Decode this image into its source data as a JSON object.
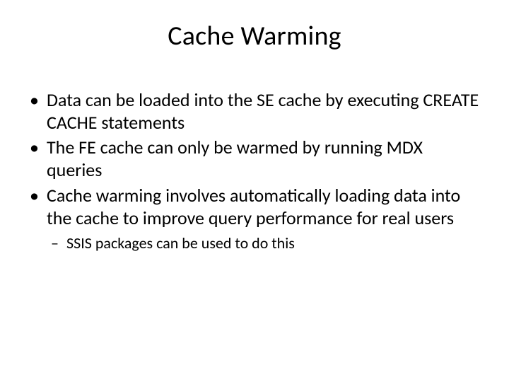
{
  "slide": {
    "title": "Cache Warming",
    "bullets": [
      {
        "text": "Data can be loaded into the SE cache by executing CREATE CACHE statements"
      },
      {
        "text": "The FE cache can only be warmed by running MDX queries"
      },
      {
        "text": "Cache warming involves automatically loading data into the cache to improve query performance for real users",
        "sub": [
          {
            "text": "SSIS packages can be used to do this"
          }
        ]
      }
    ]
  }
}
